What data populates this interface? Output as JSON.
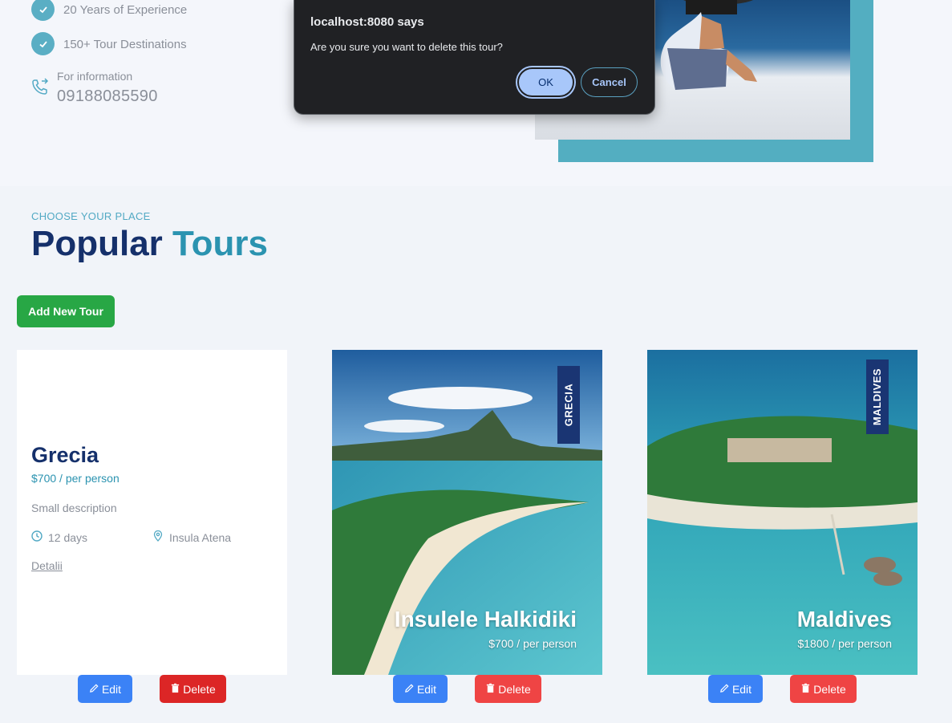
{
  "about": {
    "features": [
      "20 Years of Experience",
      "150+ Tour Destinations"
    ],
    "info_label": "For information",
    "phone": "09188085590"
  },
  "section": {
    "eyebrow": "CHOOSE YOUR PLACE",
    "title_part1": "Popular",
    "title_part2": "Tours",
    "add_button": "Add New Tour"
  },
  "tours": [
    {
      "name": "Grecia",
      "price": "$700 / per person",
      "description": "Small description",
      "duration": "12 days",
      "location": "Insula Atena",
      "details_link": "Detalii",
      "edit_label": "Edit",
      "delete_label": "Delete"
    },
    {
      "tag": "GRECIA",
      "name": "Insulele Halkidiki",
      "price": "$700 / per person",
      "edit_label": "Edit",
      "delete_label": "Delete"
    },
    {
      "tag": "MALDIVES",
      "name": "Maldives",
      "price": "$1800 / per person",
      "edit_label": "Edit",
      "delete_label": "Delete"
    }
  ],
  "dialog": {
    "title": "localhost:8080 says",
    "message": "Are you sure you want to delete this tour?",
    "ok_label": "OK",
    "cancel_label": "Cancel"
  },
  "colors": {
    "brand_navy": "#15306b",
    "brand_teal": "#2b93b0",
    "add_green": "#28a745",
    "edit_blue": "#3b82f6",
    "delete_red": "#ef4444"
  },
  "icons": {
    "check": "check-icon",
    "phone": "phone-icon",
    "clock": "clock-icon",
    "pin": "location-pin-icon",
    "pencil": "pencil-icon",
    "trash": "trash-icon"
  }
}
